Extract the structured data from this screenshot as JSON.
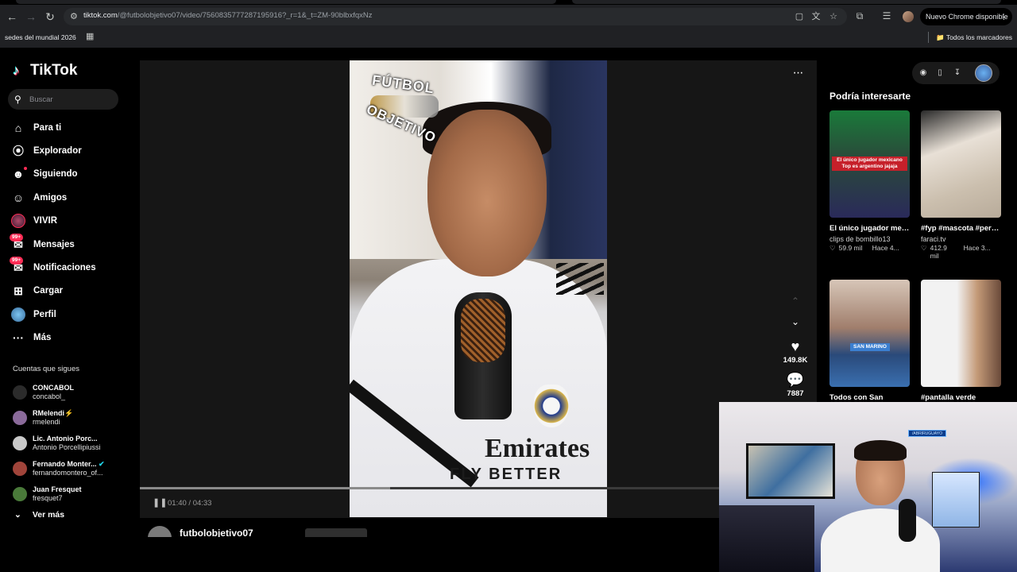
{
  "browser": {
    "url_domain": "tiktok.com",
    "url_path": "/@futbolobjetivo07/video/7560835777287195916?_r=1&_t=ZM-90blbxfqxNz",
    "update_button": "Nuevo Chrome disponible",
    "bookmark_chip": "sedes del mundial 2026",
    "all_bookmarks": "Todos los marcadores"
  },
  "app": {
    "brand": "TikTok",
    "search_placeholder": "Buscar"
  },
  "nav": {
    "items": [
      {
        "label": "Para ti",
        "icon": "home-icon"
      },
      {
        "label": "Explorador",
        "icon": "compass-icon"
      },
      {
        "label": "Siguiendo",
        "icon": "following-icon"
      },
      {
        "label": "Amigos",
        "icon": "friends-icon"
      },
      {
        "label": "VIVIR",
        "icon": "live-icon"
      },
      {
        "label": "Mensajes",
        "icon": "messages-icon",
        "badge": "99+"
      },
      {
        "label": "Notificaciones",
        "icon": "notifications-icon",
        "badge": "99+"
      },
      {
        "label": "Cargar",
        "icon": "upload-icon"
      },
      {
        "label": "Perfil",
        "icon": "profile-icon"
      },
      {
        "label": "Más",
        "icon": "more-icon"
      }
    ]
  },
  "following": {
    "title": "Cuentas que sigues",
    "accounts": [
      {
        "name": "CONCABOL",
        "handle": "concabol_",
        "color": "#2b2b2b"
      },
      {
        "name": "RMelendi⚡",
        "handle": "rmelendi",
        "color": "#8a6a9a"
      },
      {
        "name": "Lic. Antonio Porc...",
        "handle": "Antonio Porcellipiussi",
        "color": "#c9c9c9"
      },
      {
        "name": "Fernando Monter...",
        "handle": "fernandomontero_of...",
        "color": "#a0443a",
        "verified": true
      },
      {
        "name": "Juan Fresquet",
        "handle": "fresquet7",
        "color": "#4a7a3a"
      }
    ],
    "see_more": "Ver más"
  },
  "player": {
    "watermark_top": "FÚTBOL",
    "watermark_bottom": "OBJETIVO",
    "sponsor_line1": "Emirates",
    "sponsor_line2": "FLY BETTER",
    "likes": "149.8K",
    "comments": "7887",
    "time": "01:40 / 04:33",
    "progress": 0.37,
    "author": "futbolobjetivo07"
  },
  "suggestions": {
    "title": "Podría interesarte",
    "cards": [
      {
        "caption": "El único jugador mexicano en equip...",
        "author": "clips de bombillo13",
        "likes": "59.9 mil",
        "ago": "Hace 4...",
        "overlay": "El único jugador mexicano Top es argentino jajaja",
        "colors": [
          "#1a7a3a",
          "#2a2a5a"
        ]
      },
      {
        "caption": "#fyp #mascota #perro #salvabebé...",
        "author": "faraci.tv",
        "likes": "412.9 mil",
        "ago": "Hace 3...",
        "colors": [
          "#e8e0d6",
          "#b8ab9a"
        ]
      },
      {
        "caption": "Todos con San",
        "author": "",
        "likes": "",
        "ago": "",
        "overlay": "SAN MARINO",
        "colors": [
          "#d7c6b8",
          "#3a6fb0"
        ]
      },
      {
        "caption": "#pantalla verde",
        "author": "",
        "likes": "",
        "ago": "",
        "colors": [
          "#f2f2f2",
          "#c49a78"
        ]
      }
    ]
  },
  "stream_overlay": {
    "channel_tag": "/ABRIRUGUAYO"
  }
}
